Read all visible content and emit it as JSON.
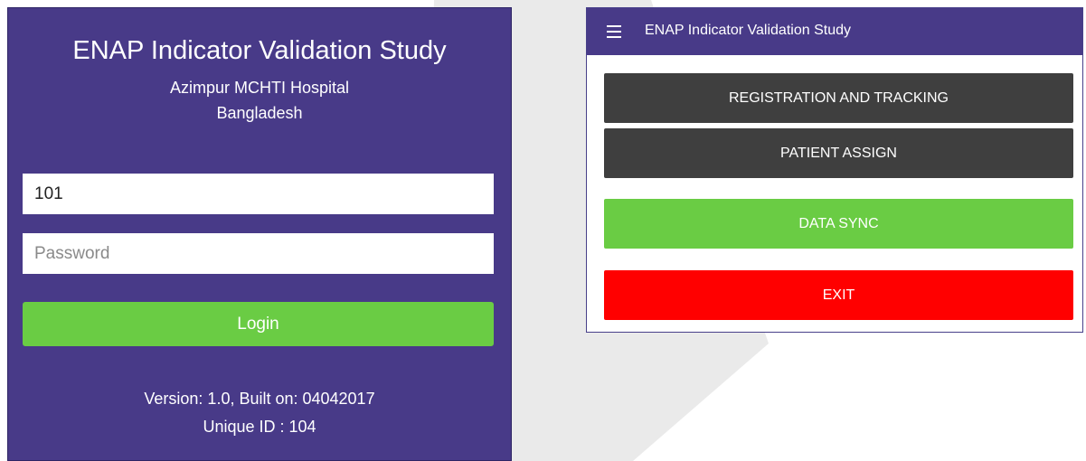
{
  "login": {
    "title": "ENAP Indicator Validation Study",
    "hospital": "Azimpur MCHTI Hospital",
    "country": "Bangladesh",
    "username_value": "101",
    "password_placeholder": "Password",
    "login_label": "Login",
    "version_text": "Version: 1.0, Built on: 04042017",
    "unique_id_text": "Unique ID : 104",
    "background_color": "#483a88",
    "login_button_color": "#6acc44"
  },
  "menu": {
    "app_title": "ENAP Indicator Validation Study",
    "menu_icon": "hamburger-menu-icon",
    "buttons": [
      {
        "label": "REGISTRATION AND TRACKING",
        "color": "#3f3f3f"
      },
      {
        "label": "PATIENT ASSIGN",
        "color": "#3f3f3f"
      },
      {
        "label": "DATA SYNC",
        "color": "#6acc44"
      },
      {
        "label": "EXIT",
        "color": "#ff0000"
      }
    ]
  }
}
